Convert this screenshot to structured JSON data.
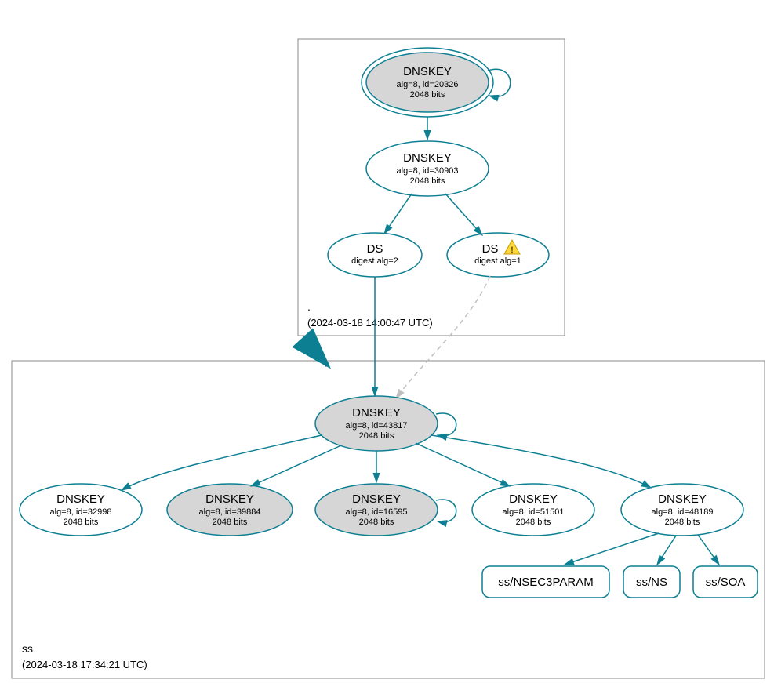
{
  "colors": {
    "edge": "#0d7f93",
    "edge_dashed": "#bfbfbf",
    "shaded_fill": "#d6d6d6",
    "zone_border": "#888888"
  },
  "zones": {
    "root": {
      "name": ".",
      "timestamp": "(2024-03-18 14:00:47 UTC)"
    },
    "ss": {
      "name": "ss",
      "timestamp": "(2024-03-18 17:34:21 UTC)"
    }
  },
  "nodes": {
    "root_ksk": {
      "title": "DNSKEY",
      "line1": "alg=8, id=20326",
      "line2": "2048 bits"
    },
    "root_zsk": {
      "title": "DNSKEY",
      "line1": "alg=8, id=30903",
      "line2": "2048 bits"
    },
    "ds2": {
      "title": "DS",
      "line1": "digest alg=2"
    },
    "ds1": {
      "title": "DS",
      "line1": "digest alg=1"
    },
    "ss_ksk": {
      "title": "DNSKEY",
      "line1": "alg=8, id=43817",
      "line2": "2048 bits"
    },
    "ss_k1": {
      "title": "DNSKEY",
      "line1": "alg=8, id=32998",
      "line2": "2048 bits"
    },
    "ss_k2": {
      "title": "DNSKEY",
      "line1": "alg=8, id=39884",
      "line2": "2048 bits"
    },
    "ss_k3": {
      "title": "DNSKEY",
      "line1": "alg=8, id=16595",
      "line2": "2048 bits"
    },
    "ss_k4": {
      "title": "DNSKEY",
      "line1": "alg=8, id=51501",
      "line2": "2048 bits"
    },
    "ss_k5": {
      "title": "DNSKEY",
      "line1": "alg=8, id=48189",
      "line2": "2048 bits"
    }
  },
  "rrsets": {
    "nsec3": "ss/NSEC3PARAM",
    "ns": "ss/NS",
    "soa": "ss/SOA"
  }
}
